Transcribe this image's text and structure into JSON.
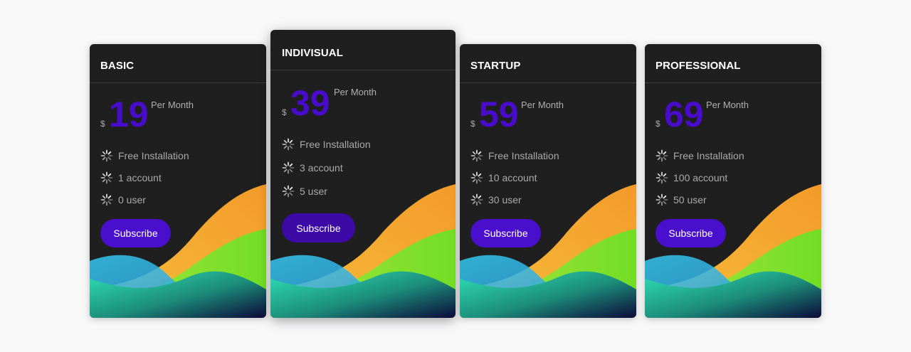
{
  "plans": [
    {
      "name": "BASIC",
      "currency": "$",
      "price": "19",
      "period": "Per Month",
      "features": [
        "Free Installation",
        "1 account",
        "0 user"
      ],
      "button": "Subscribe"
    },
    {
      "name": "INDIVISUAL",
      "currency": "$",
      "price": "39",
      "period": "Per Month",
      "features": [
        "Free Installation",
        "3 account",
        "5 user"
      ],
      "button": "Subscribe"
    },
    {
      "name": "STARTUP",
      "currency": "$",
      "price": "59",
      "period": "Per Month",
      "features": [
        "Free Installation",
        "10 account",
        "30 user"
      ],
      "button": "Subscribe"
    },
    {
      "name": "PROFESSIONAL",
      "currency": "$",
      "price": "69",
      "period": "Per Month",
      "features": [
        "Free Installation",
        "100 account",
        "50 user"
      ],
      "button": "Subscribe"
    }
  ],
  "colors": {
    "page_background": "#f8f8f9",
    "card_background": "#1f1f1f",
    "price_accent": "#4a0ccc",
    "button_background": "#4a0fcc",
    "wave_orange": "#f39a2a",
    "wave_green": "#72dd25",
    "wave_cyan": "#35c9f0"
  },
  "icons": {
    "feature_icon": "spinner-icon"
  }
}
